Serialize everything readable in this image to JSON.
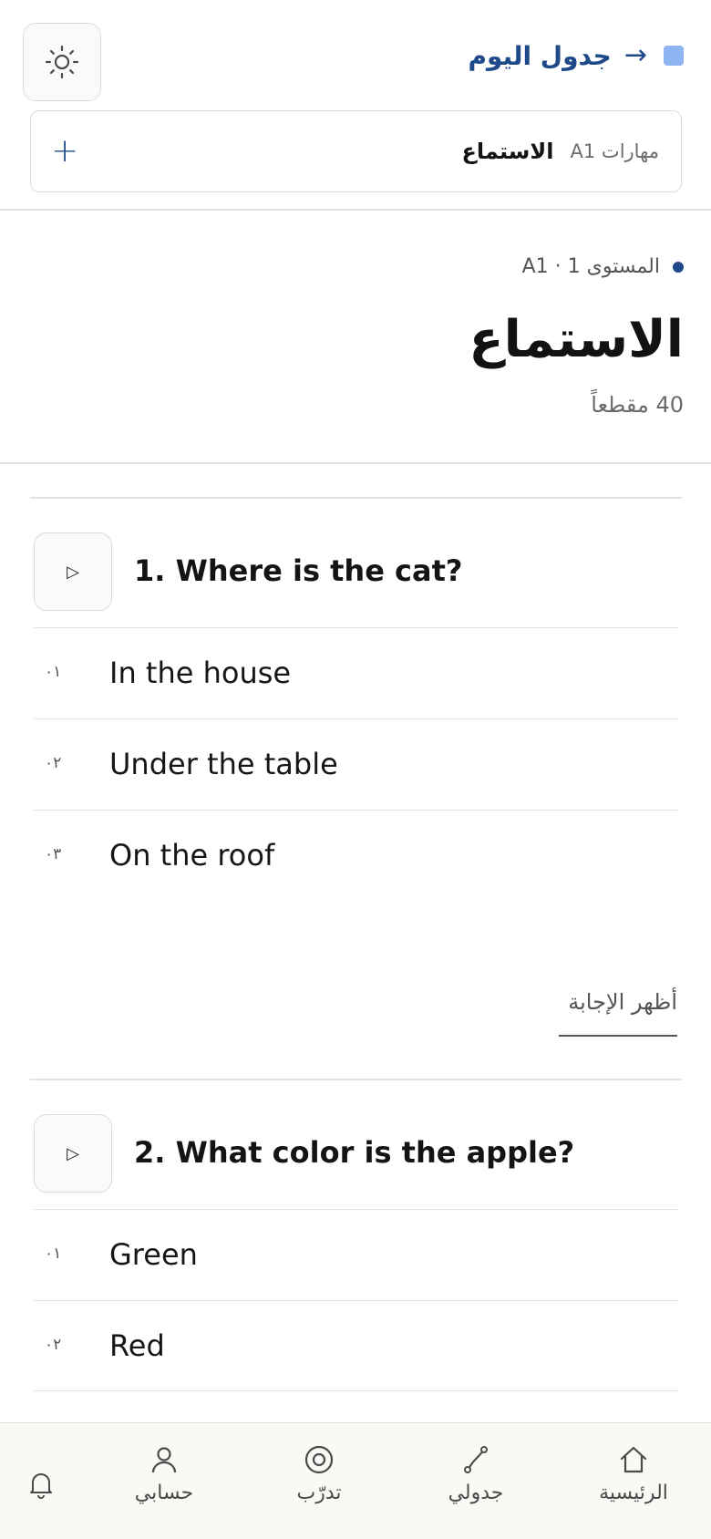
{
  "header": {
    "theme_icon": "sun-icon",
    "today_label": "جدول اليوم",
    "today_arrow": "→"
  },
  "skill_bar": {
    "muted": "مهارات A1",
    "strong": "الاستماع",
    "add": "+"
  },
  "section": {
    "level": "المستوى A1 · 1",
    "title": "الاستماع",
    "count": "40 مقطعاً"
  },
  "questions": [
    {
      "text": "1. Where is the cat?",
      "options": [
        {
          "num": "٠١",
          "text": "In the house"
        },
        {
          "num": "٠٢",
          "text": "Under the table"
        },
        {
          "num": "٠٣",
          "text": "On the roof"
        }
      ],
      "show_answer": "أظهر الإجابة"
    },
    {
      "text": "2. What color is the apple?",
      "options": [
        {
          "num": "٠١",
          "text": "Green"
        },
        {
          "num": "٠٢",
          "text": "Red"
        }
      ]
    }
  ],
  "play_glyph": "▷",
  "nav": {
    "home": "الرئيسية",
    "schedule": "جدولي",
    "practice": "تدرّب",
    "account": "حسابي"
  },
  "colors": {
    "accent": "#1e4a8a",
    "accent_light": "#8fb4f2",
    "border": "#dcdad5",
    "nav_bg": "#faf9f6"
  }
}
